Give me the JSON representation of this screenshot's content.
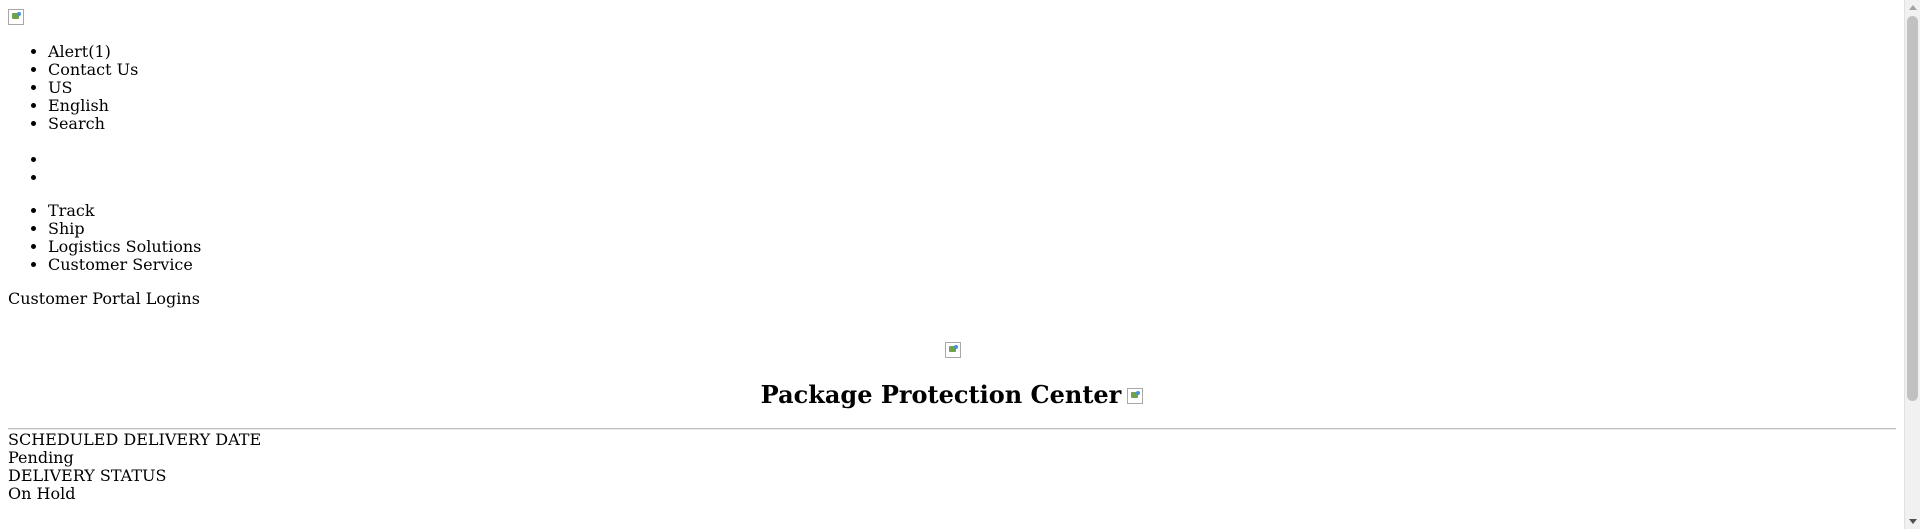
{
  "header": {
    "logo_icon": "broken-image-icon",
    "utility_links": [
      "Alert(1)",
      "Contact Us",
      "US",
      "English",
      "Search"
    ],
    "empty_items_count": 2,
    "nav_links": [
      "Track",
      "Ship",
      "Logistics Solutions",
      "Customer Service"
    ],
    "portal_logins": "Customer Portal Logins"
  },
  "main": {
    "center_icon": "broken-image-icon",
    "title": "Package Protection Center",
    "title_icon": "broken-image-icon",
    "scheduled_delivery_label": "SCHEDULED DELIVERY DATE",
    "scheduled_delivery_value": "Pending",
    "delivery_status_label": "DELIVERY STATUS",
    "delivery_status_value": "On Hold"
  },
  "colors": {
    "background": "#ffffff",
    "text": "#000000",
    "scrollbar_track": "#f1f1f1",
    "scrollbar_thumb": "#c1c1c1"
  }
}
